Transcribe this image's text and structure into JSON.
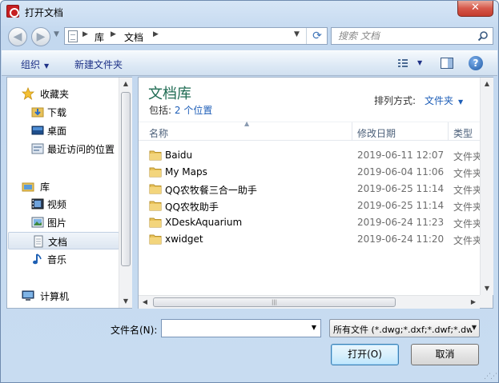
{
  "window": {
    "title": "打开文档",
    "close_glyph": "✕"
  },
  "address_bar": {
    "crumbs": [
      "库",
      "文档"
    ],
    "separator": "▶"
  },
  "search": {
    "placeholder": "搜索 文档"
  },
  "toolbar": {
    "organize_label": "组织",
    "new_folder_label": "新建文件夹",
    "help_glyph": "?"
  },
  "sidebar": {
    "items": [
      {
        "label": "收藏夹",
        "icon": "star-icon"
      },
      {
        "label": "下载",
        "icon": "download-folder-icon"
      },
      {
        "label": "桌面",
        "icon": "desktop-icon"
      },
      {
        "label": "最近访问的位置",
        "icon": "recent-places-icon"
      },
      {
        "label": "库",
        "icon": "library-icon"
      },
      {
        "label": "视频",
        "icon": "video-icon"
      },
      {
        "label": "图片",
        "icon": "pictures-icon"
      },
      {
        "label": "文档",
        "icon": "documents-icon",
        "selected": true
      },
      {
        "label": "音乐",
        "icon": "music-icon"
      },
      {
        "label": "计算机",
        "icon": "computer-icon"
      }
    ]
  },
  "library": {
    "title": "文档库",
    "includes_prefix": "包括:",
    "includes_link": "2 个位置",
    "arrange_label": "排列方式:",
    "arrange_value": "文件夹"
  },
  "columns": {
    "name": "名称",
    "date": "修改日期",
    "type": "类型"
  },
  "files": [
    {
      "name": "Baidu",
      "date": "2019-06-11 12:07",
      "type": "文件夹"
    },
    {
      "name": "My Maps",
      "date": "2019-06-04 11:06",
      "type": "文件夹"
    },
    {
      "name": "QQ农牧餐三合一助手",
      "date": "2019-06-25 11:14",
      "type": "文件夹"
    },
    {
      "name": "QQ农牧助手",
      "date": "2019-06-25 11:14",
      "type": "文件夹"
    },
    {
      "name": "XDeskAquarium",
      "date": "2019-06-24 11:23",
      "type": "文件夹"
    },
    {
      "name": "xwidget",
      "date": "2019-06-24 11:20",
      "type": "文件夹"
    }
  ],
  "footer": {
    "filename_label": "文件名(N):",
    "filename_value": "",
    "filter_value": "所有文件 (*.dwg;*.dxf;*.dwf;*.dwt)",
    "open_label": "打开(O)",
    "cancel_label": "取消"
  },
  "colors": {
    "accent": "#1f5fb8",
    "library_title": "#1e6b52",
    "folder": "#e8c25a"
  }
}
